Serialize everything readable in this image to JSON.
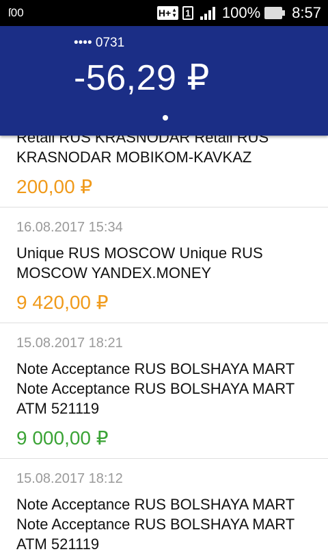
{
  "status_bar": {
    "left_icon_text": "ſ00",
    "network_type": "H+",
    "sim_slot": "1",
    "battery_percent": "100%",
    "time": "8:57"
  },
  "header": {
    "card_mask": "•••• 0731",
    "balance": "-56,29 ₽"
  },
  "transactions": [
    {
      "date": "",
      "description": "Retail RUS KRASNODAR Retail RUS KRASNODAR MOBIKOM-KAVKAZ",
      "amount": "200,00 ₽",
      "amount_color": "#f09a1a"
    },
    {
      "date": "16.08.2017 15:34",
      "description": "Unique RUS MOSCOW Unique RUS MOSCOW YANDEX.MONEY",
      "amount": "9 420,00 ₽",
      "amount_color": "#f09a1a"
    },
    {
      "date": "15.08.2017 18:21",
      "description": "Note Acceptance RUS BOLSHAYA MART Note Acceptance RUS BOLSHAYA MART ATM 521119",
      "amount": "9 000,00 ₽",
      "amount_color": "#3aa335"
    },
    {
      "date": "15.08.2017 18:12",
      "description": "Note Acceptance RUS BOLSHAYA MART Note Acceptance RUS BOLSHAYA MART ATM 521119",
      "amount": "",
      "amount_color": "#3aa335"
    }
  ]
}
